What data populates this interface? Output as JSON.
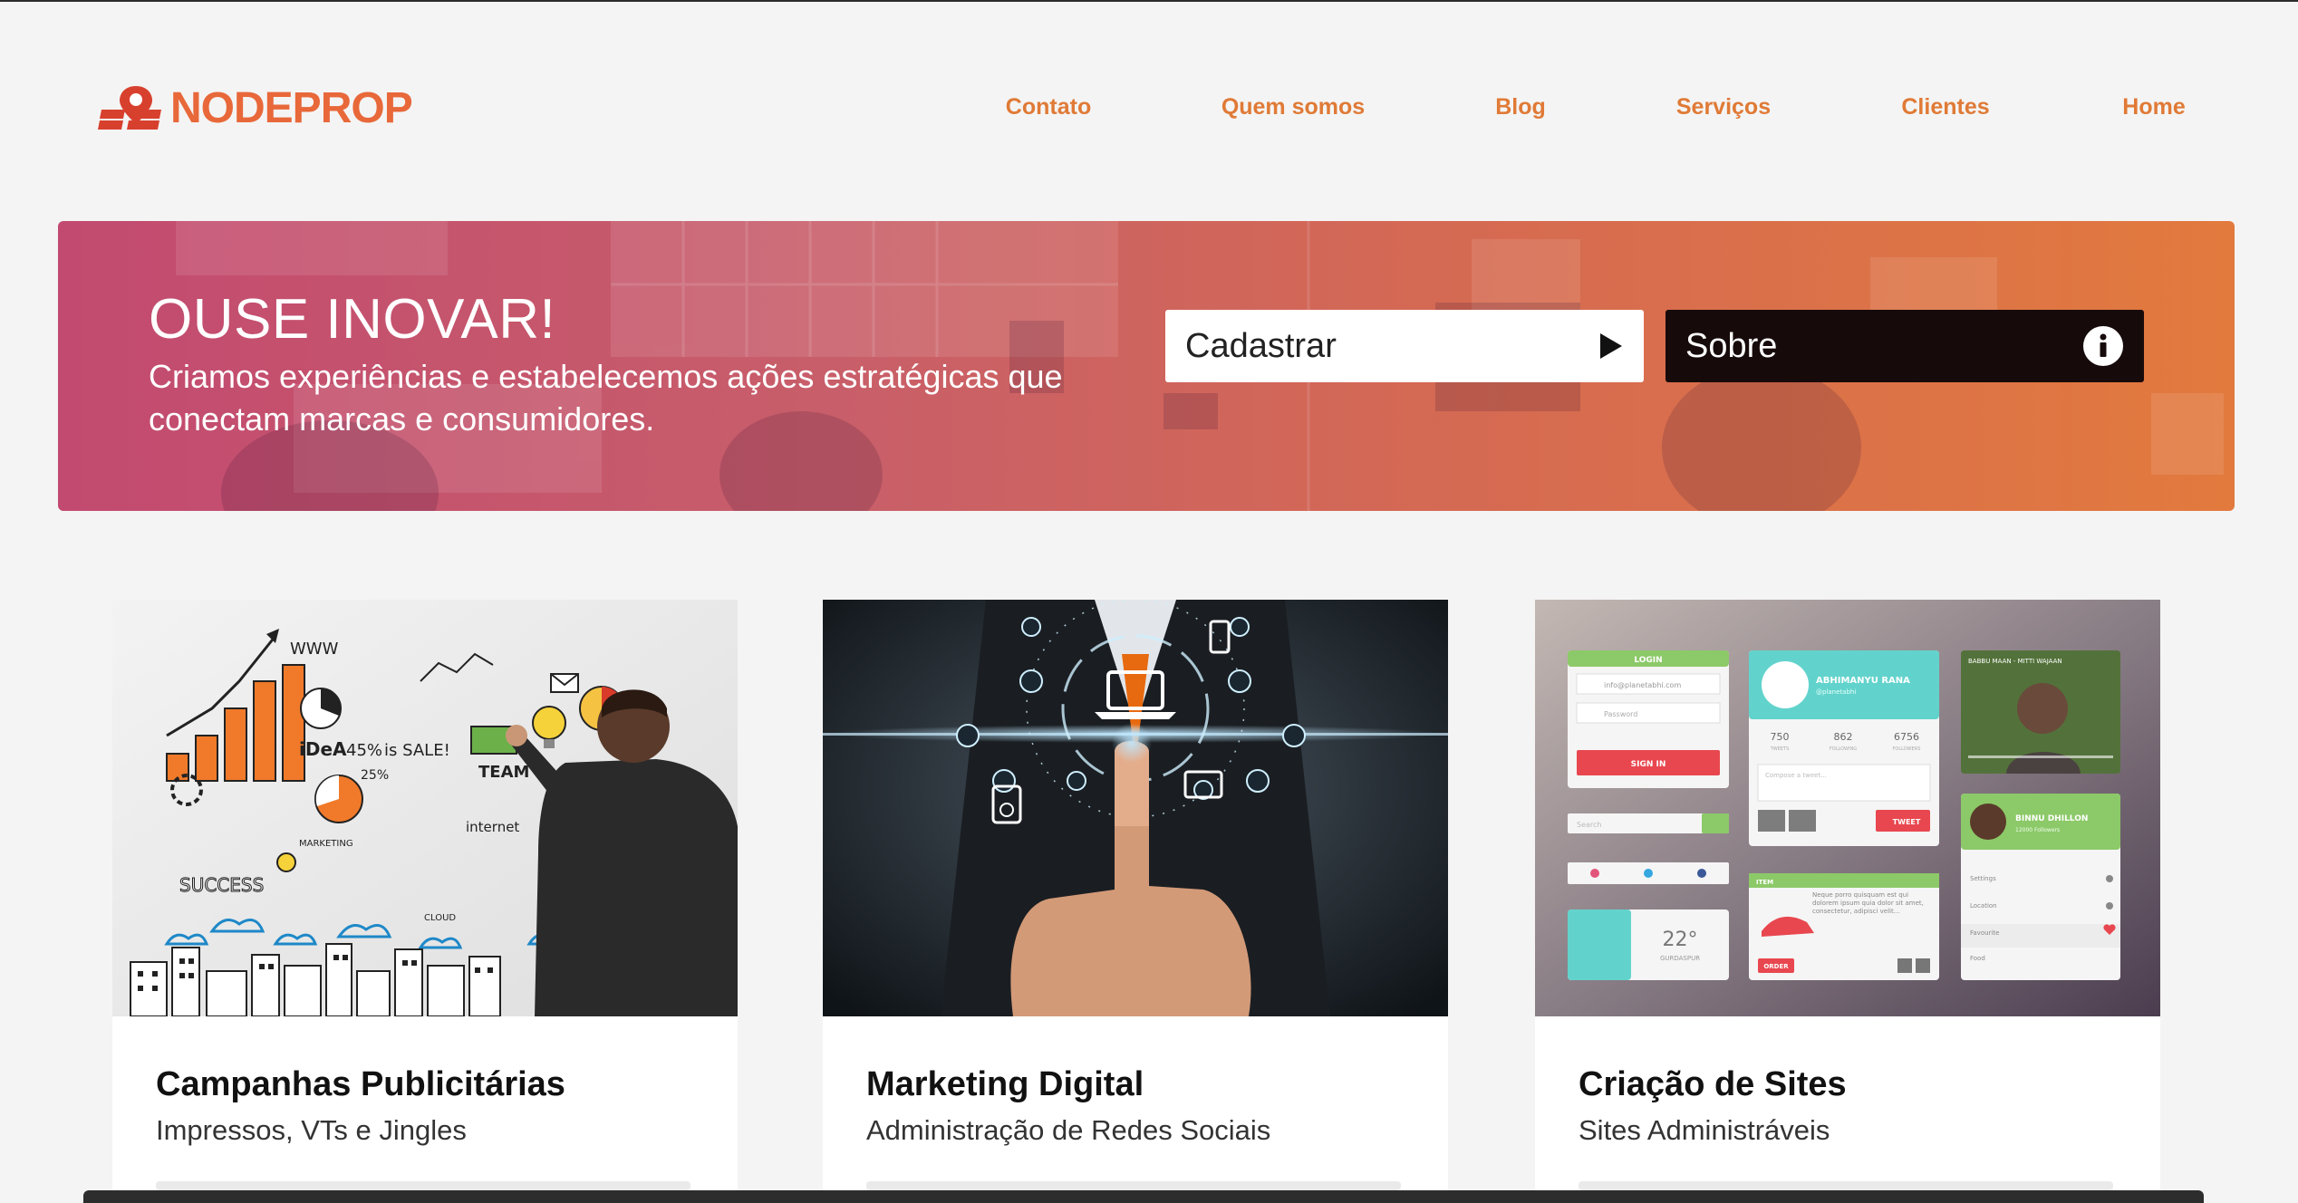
{
  "brand": {
    "name": "NODEPROP",
    "color": "#e8683a"
  },
  "nav": {
    "items": [
      {
        "label": "Contato"
      },
      {
        "label": "Quem somos"
      },
      {
        "label": "Blog"
      },
      {
        "label": "Serviços"
      },
      {
        "label": "Clientes"
      },
      {
        "label": "Home"
      }
    ],
    "color": "#e07a36"
  },
  "hero": {
    "title": "OUSE INOVAR!",
    "subtitle": "Criamos experiências e estabelecemos ações estratégicas que conectam marcas e consumidores.",
    "cadastrar_label": "Cadastrar",
    "cadastrar_icon": "play-icon",
    "sobre_label": "Sobre",
    "sobre_icon": "info-icon",
    "gradient": [
      "#c24a70",
      "#e27a3e"
    ]
  },
  "cards": [
    {
      "title": "Campanhas Publicitárias",
      "subtitle": "Impressos, VTs e Jingles",
      "image": "businessman-whiteboard-sketch-image",
      "sketch_words": [
        "WWW",
        "iDeA",
        "45%",
        "is SALE!",
        "TEAM",
        "internet",
        "SUCCESS",
        "MARKETING",
        "CLOUD",
        "25%"
      ]
    },
    {
      "title": "Marketing Digital",
      "subtitle": "Administração de Redes Sociais",
      "image": "finger-touching-digital-icons-image"
    },
    {
      "title": "Criação de Sites",
      "subtitle": "Sites Administráveis",
      "image": "flat-ui-kit-mockup-image",
      "mockup": {
        "login_title": "LOGIN",
        "email_placeholder": "info@planetabhi.com",
        "password_placeholder": "Password",
        "signin_label": "SIGN IN",
        "search_placeholder": "Search",
        "profile_name": "ABHIMANYU RANA",
        "profile_handle": "@planetabhi",
        "stats": [
          {
            "value": "750",
            "label": "TWEETS"
          },
          {
            "value": "862",
            "label": "FOLLOWING"
          },
          {
            "value": "6756",
            "label": "FOLLOWERS"
          }
        ],
        "compose_placeholder": "Compose a tweet...",
        "tweet_label": "TWEET",
        "video_title": "BABBU MAAN - MITTI WAJAAN",
        "user2_name": "BINNU DHILLON",
        "user2_followers": "12000 Followers",
        "menu": [
          "Settings",
          "Location",
          "Favourite",
          "Food"
        ],
        "item_title": "ITEM",
        "item_text": "Neque porro quisquam est qui dolorem ipsum quia dolor sit amet, consectetur, adipisci velit...",
        "order_label": "ORDER",
        "weather_temp": "22°",
        "weather_city": "GURDASPUR"
      }
    }
  ]
}
